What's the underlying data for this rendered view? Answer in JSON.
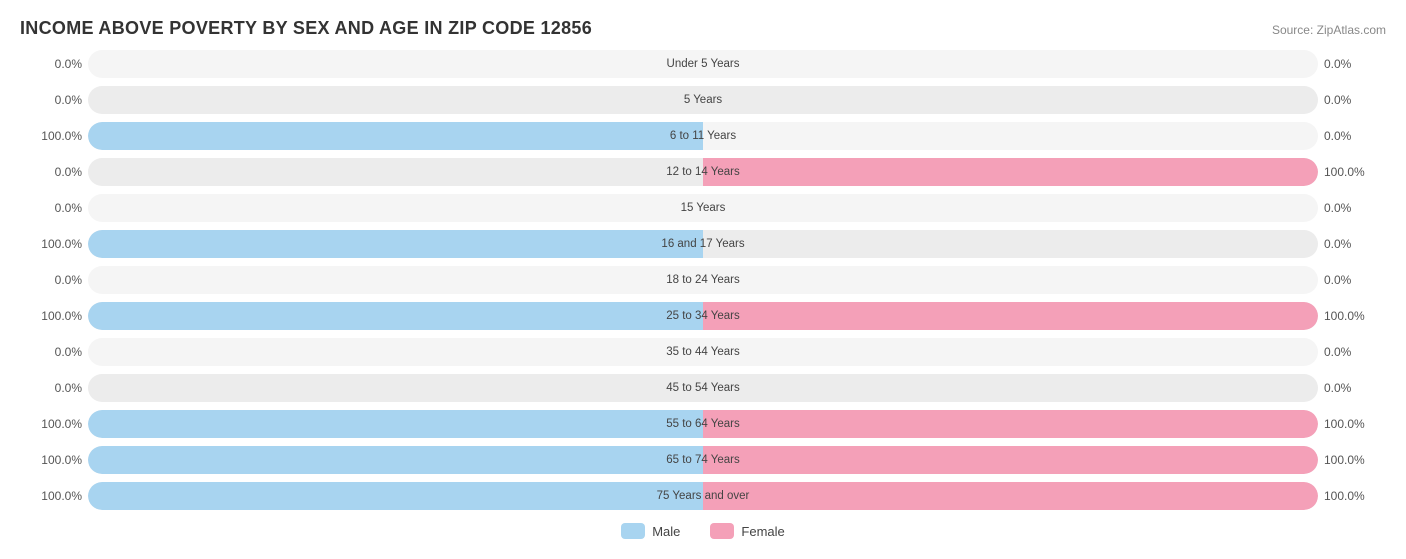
{
  "title": "INCOME ABOVE POVERTY BY SEX AND AGE IN ZIP CODE 12856",
  "source": "Source: ZipAtlas.com",
  "colors": {
    "male": "#a8d4f0",
    "female": "#f4a0b8"
  },
  "legend": {
    "male_label": "Male",
    "female_label": "Female"
  },
  "rows": [
    {
      "label": "Under 5 Years",
      "left_val": "0.0%",
      "right_val": "0.0%",
      "left_pct": 0,
      "right_pct": 0
    },
    {
      "label": "5 Years",
      "left_val": "0.0%",
      "right_val": "0.0%",
      "left_pct": 0,
      "right_pct": 0
    },
    {
      "label": "6 to 11 Years",
      "left_val": "100.0%",
      "right_val": "0.0%",
      "left_pct": 100,
      "right_pct": 0
    },
    {
      "label": "12 to 14 Years",
      "left_val": "0.0%",
      "right_val": "100.0%",
      "left_pct": 0,
      "right_pct": 100
    },
    {
      "label": "15 Years",
      "left_val": "0.0%",
      "right_val": "0.0%",
      "left_pct": 0,
      "right_pct": 0
    },
    {
      "label": "16 and 17 Years",
      "left_val": "100.0%",
      "right_val": "0.0%",
      "left_pct": 100,
      "right_pct": 0
    },
    {
      "label": "18 to 24 Years",
      "left_val": "0.0%",
      "right_val": "0.0%",
      "left_pct": 0,
      "right_pct": 0
    },
    {
      "label": "25 to 34 Years",
      "left_val": "100.0%",
      "right_val": "100.0%",
      "left_pct": 100,
      "right_pct": 100
    },
    {
      "label": "35 to 44 Years",
      "left_val": "0.0%",
      "right_val": "0.0%",
      "left_pct": 0,
      "right_pct": 0
    },
    {
      "label": "45 to 54 Years",
      "left_val": "0.0%",
      "right_val": "0.0%",
      "left_pct": 0,
      "right_pct": 0
    },
    {
      "label": "55 to 64 Years",
      "left_val": "100.0%",
      "right_val": "100.0%",
      "left_pct": 100,
      "right_pct": 100
    },
    {
      "label": "65 to 74 Years",
      "left_val": "100.0%",
      "right_val": "100.0%",
      "left_pct": 100,
      "right_pct": 100
    },
    {
      "label": "75 Years and over",
      "left_val": "100.0%",
      "right_val": "100.0%",
      "left_pct": 100,
      "right_pct": 100
    }
  ]
}
